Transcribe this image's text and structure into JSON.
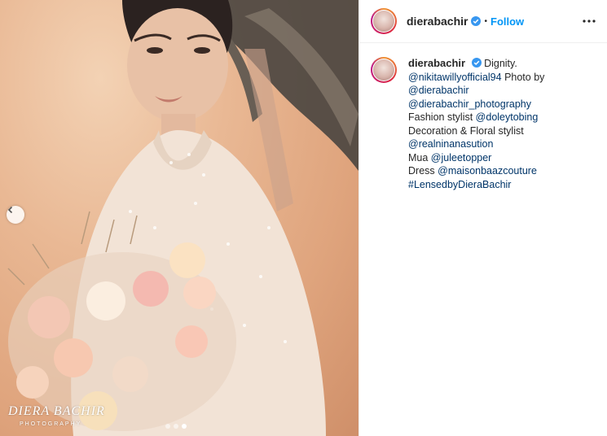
{
  "post": {
    "username": "dierabachir",
    "follow_label": "Follow",
    "separator": "•",
    "caption": {
      "first_word": "Dignity.",
      "lines": [
        [
          {
            "t": "@nikitawillyofficial94",
            "link": true
          },
          {
            "t": " Photo by",
            "link": false
          }
        ],
        [
          {
            "t": "@dierabachir",
            "link": true
          }
        ],
        [
          {
            "t": "@dierabachir_photography",
            "link": true
          }
        ],
        [
          {
            "t": "Fashion stylist ",
            "link": false
          },
          {
            "t": "@doleytobing",
            "link": true
          }
        ],
        [
          {
            "t": "Decoration & Floral stylist",
            "link": false
          }
        ],
        [
          {
            "t": "@realninanasution",
            "link": true
          }
        ],
        [
          {
            "t": "Mua ",
            "link": false
          },
          {
            "t": "@juleetopper",
            "link": true
          }
        ],
        [
          {
            "t": "Dress ",
            "link": false
          },
          {
            "t": "@maisonbaazcouture",
            "link": true
          }
        ],
        [
          {
            "t": "#LensedbyDieraBachir",
            "link": true
          }
        ]
      ]
    }
  },
  "photo": {
    "watermark": "DIERA BACHIR",
    "watermark_sub": "PHOTOGRAPHY",
    "carousel": {
      "count": 3,
      "active_index": 2
    }
  },
  "icons": {
    "verified": "verified-badge-icon",
    "more": "more-options-icon",
    "prev": "chevron-left-icon"
  },
  "colors": {
    "link": "#003569",
    "follow": "#0095f6",
    "verified": "#3897f0"
  }
}
